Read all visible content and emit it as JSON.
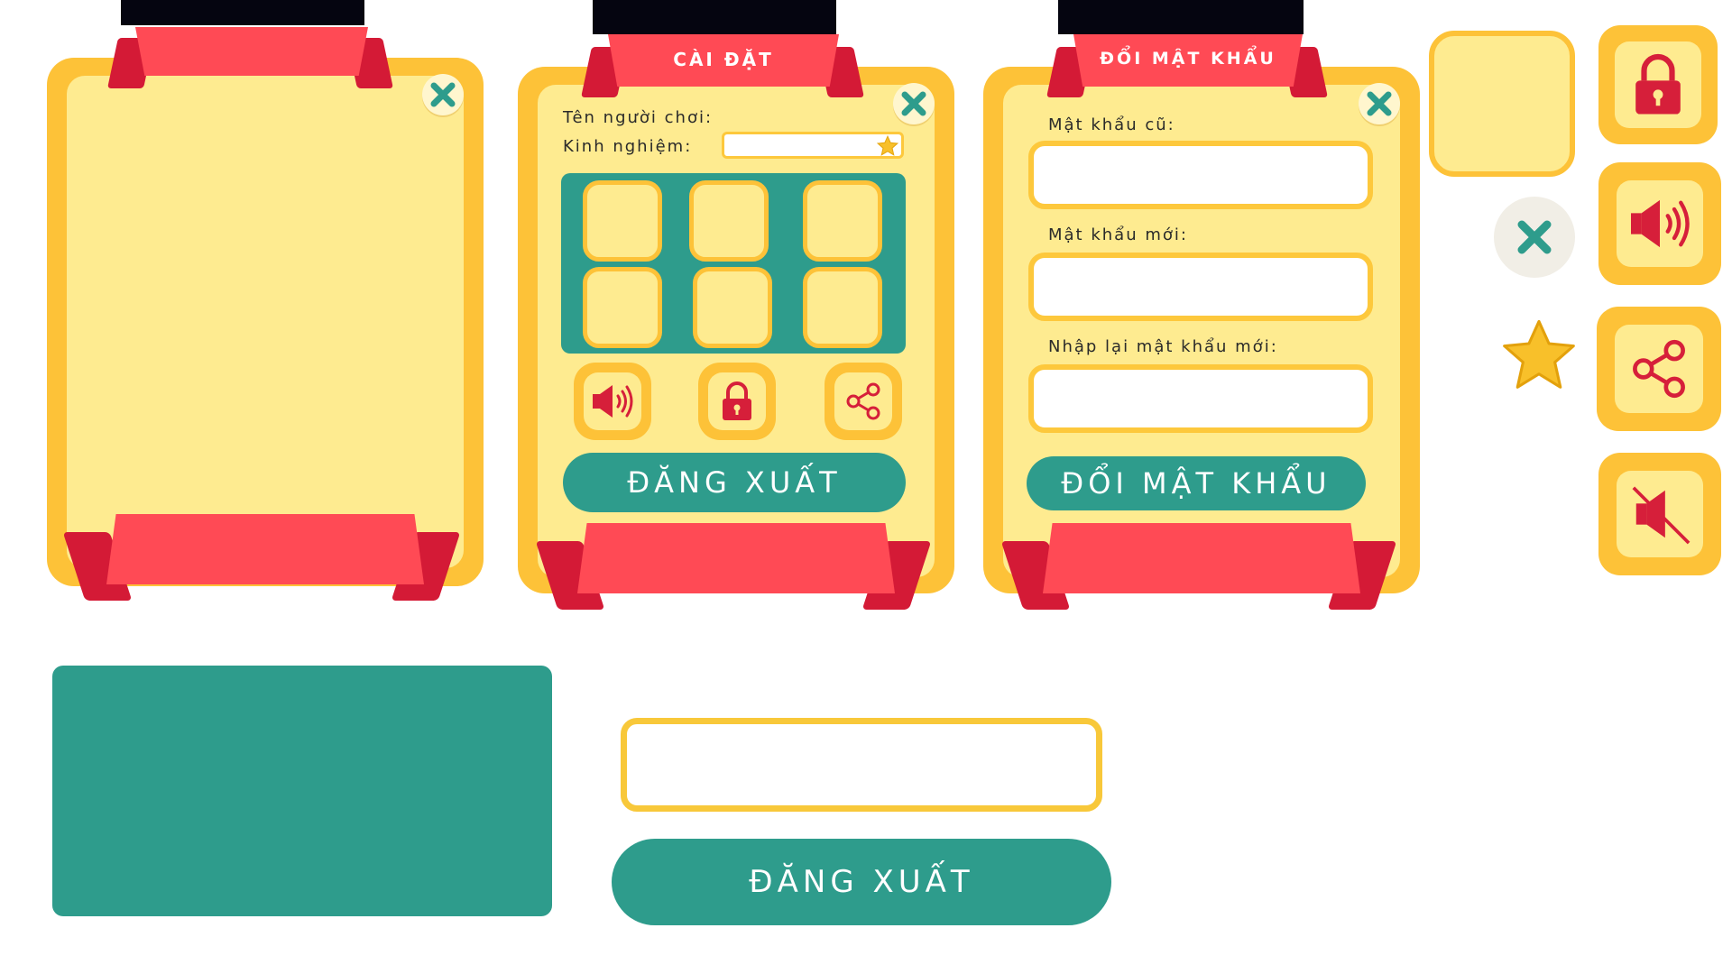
{
  "settings_panel": {
    "title": "CÀI ĐẶT",
    "player_name_label": "Tên người chơi:",
    "experience_label": "Kinh nghiệm:",
    "experience_value": "",
    "logout_label": "ĐĂNG XUẤT"
  },
  "password_panel": {
    "title": "ĐỔI MẬT KHẨU",
    "old_password_label": "Mật khẩu cũ:",
    "new_password_label": "Mật khẩu mới:",
    "confirm_password_label": "Nhập lại mật khẩu mới:",
    "old_password_value": "",
    "new_password_value": "",
    "confirm_password_value": "",
    "submit_label": "ĐỔI MẬT KHẨU"
  },
  "standalone": {
    "input_value": "",
    "logout_label": "ĐĂNG XUẤT"
  },
  "colors": {
    "frame": "#fdc238",
    "panel_fill": "#feeb90",
    "ribbon": "#ff4a55",
    "ribbon_dark": "#d41a36",
    "teal": "#2e9c8c",
    "icon_red": "#d61f3a"
  },
  "icons": [
    "close-icon",
    "lock-icon",
    "speaker-icon",
    "share-icon",
    "mute-icon",
    "star-icon"
  ]
}
